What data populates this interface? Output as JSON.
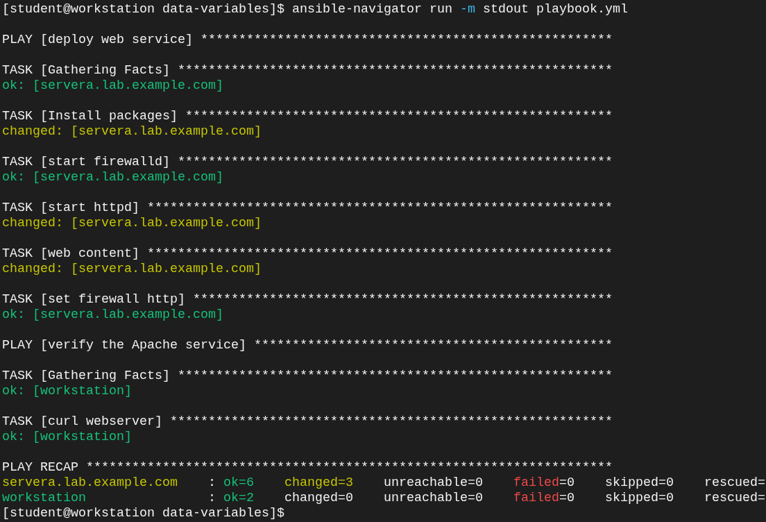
{
  "terminal": {
    "lines": [
      {
        "kind": "text",
        "segments": [
          {
            "text": "[student@workstation data-variables]$ ansible-navigator run ",
            "kind": "plain"
          },
          {
            "text": "-m",
            "kind": "option"
          },
          {
            "text": " stdout playbook.yml",
            "kind": "plain"
          }
        ]
      },
      {
        "kind": "blank"
      },
      {
        "kind": "text",
        "segments": [
          {
            "text": "PLAY [deploy web service] ******************************************************",
            "kind": "plain"
          }
        ]
      },
      {
        "kind": "blank"
      },
      {
        "kind": "text",
        "segments": [
          {
            "text": "TASK [Gathering Facts] *********************************************************",
            "kind": "plain"
          }
        ]
      },
      {
        "kind": "text",
        "segments": [
          {
            "text": "ok: [servera.lab.example.com]",
            "kind": "ok"
          }
        ]
      },
      {
        "kind": "blank"
      },
      {
        "kind": "text",
        "segments": [
          {
            "text": "TASK [Install packages] ********************************************************",
            "kind": "plain"
          }
        ]
      },
      {
        "kind": "text",
        "segments": [
          {
            "text": "changed: [servera.lab.example.com]",
            "kind": "changed"
          }
        ]
      },
      {
        "kind": "blank"
      },
      {
        "kind": "text",
        "segments": [
          {
            "text": "TASK [start firewalld] *********************************************************",
            "kind": "plain"
          }
        ]
      },
      {
        "kind": "text",
        "segments": [
          {
            "text": "ok: [servera.lab.example.com]",
            "kind": "ok"
          }
        ]
      },
      {
        "kind": "blank"
      },
      {
        "kind": "text",
        "segments": [
          {
            "text": "TASK [start httpd] *************************************************************",
            "kind": "plain"
          }
        ]
      },
      {
        "kind": "text",
        "segments": [
          {
            "text": "changed: [servera.lab.example.com]",
            "kind": "changed"
          }
        ]
      },
      {
        "kind": "blank"
      },
      {
        "kind": "text",
        "segments": [
          {
            "text": "TASK [web content] *************************************************************",
            "kind": "plain"
          }
        ]
      },
      {
        "kind": "text",
        "segments": [
          {
            "text": "changed: [servera.lab.example.com]",
            "kind": "changed"
          }
        ]
      },
      {
        "kind": "blank"
      },
      {
        "kind": "text",
        "segments": [
          {
            "text": "TASK [set firewall http] *******************************************************",
            "kind": "plain"
          }
        ]
      },
      {
        "kind": "text",
        "segments": [
          {
            "text": "ok: [servera.lab.example.com]",
            "kind": "ok"
          }
        ]
      },
      {
        "kind": "blank"
      },
      {
        "kind": "text",
        "segments": [
          {
            "text": "PLAY [verify the Apache service] ***********************************************",
            "kind": "plain"
          }
        ]
      },
      {
        "kind": "blank"
      },
      {
        "kind": "text",
        "segments": [
          {
            "text": "TASK [Gathering Facts] *********************************************************",
            "kind": "plain"
          }
        ]
      },
      {
        "kind": "text",
        "segments": [
          {
            "text": "ok: [workstation]",
            "kind": "ok"
          }
        ]
      },
      {
        "kind": "blank"
      },
      {
        "kind": "text",
        "segments": [
          {
            "text": "TASK [curl webserver] **********************************************************",
            "kind": "plain"
          }
        ]
      },
      {
        "kind": "text",
        "segments": [
          {
            "text": "ok: [workstation]",
            "kind": "ok"
          }
        ]
      },
      {
        "kind": "blank"
      },
      {
        "kind": "text",
        "segments": [
          {
            "text": "PLAY RECAP *********************************************************************",
            "kind": "plain"
          }
        ]
      },
      {
        "kind": "text",
        "segments": [
          {
            "text": "servera.lab.example.com",
            "kind": "changed"
          },
          {
            "text": "    : ",
            "kind": "plain"
          },
          {
            "text": "ok=6",
            "kind": "ok"
          },
          {
            "text": "    changed=3",
            "kind": "changed"
          },
          {
            "text": "    unreachable=0    ",
            "kind": "plain"
          },
          {
            "text": "failed",
            "kind": "failed"
          },
          {
            "text": "=0    skipped=0    rescued=",
            "kind": "plain"
          }
        ]
      },
      {
        "kind": "text",
        "segments": [
          {
            "text": "workstation",
            "kind": "ok"
          },
          {
            "text": "                : ",
            "kind": "plain"
          },
          {
            "text": "ok=2",
            "kind": "ok"
          },
          {
            "text": "    changed=0    unreachable=0    ",
            "kind": "plain"
          },
          {
            "text": "failed",
            "kind": "failed"
          },
          {
            "text": "=0    skipped=0    rescued=",
            "kind": "plain"
          }
        ]
      },
      {
        "kind": "text",
        "segments": [
          {
            "text": "[student@workstation data-variables]$",
            "kind": "plain"
          }
        ]
      }
    ]
  }
}
